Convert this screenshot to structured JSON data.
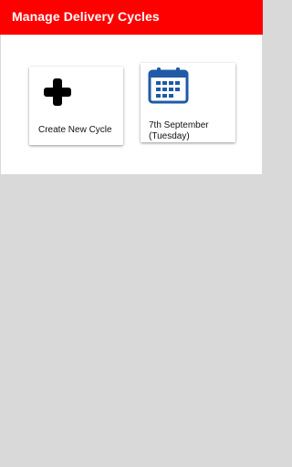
{
  "app_bar": {
    "title": "Manage Delivery Cycles",
    "background_color": "#ff0000"
  },
  "cards": {
    "create": {
      "label": "Create New Cycle",
      "icon": "plus-icon"
    },
    "cycle": {
      "date_line": "7th September",
      "day_line": "(Tuesday)",
      "icon": "calendar-icon",
      "icon_color": "#1f5aa6"
    }
  }
}
